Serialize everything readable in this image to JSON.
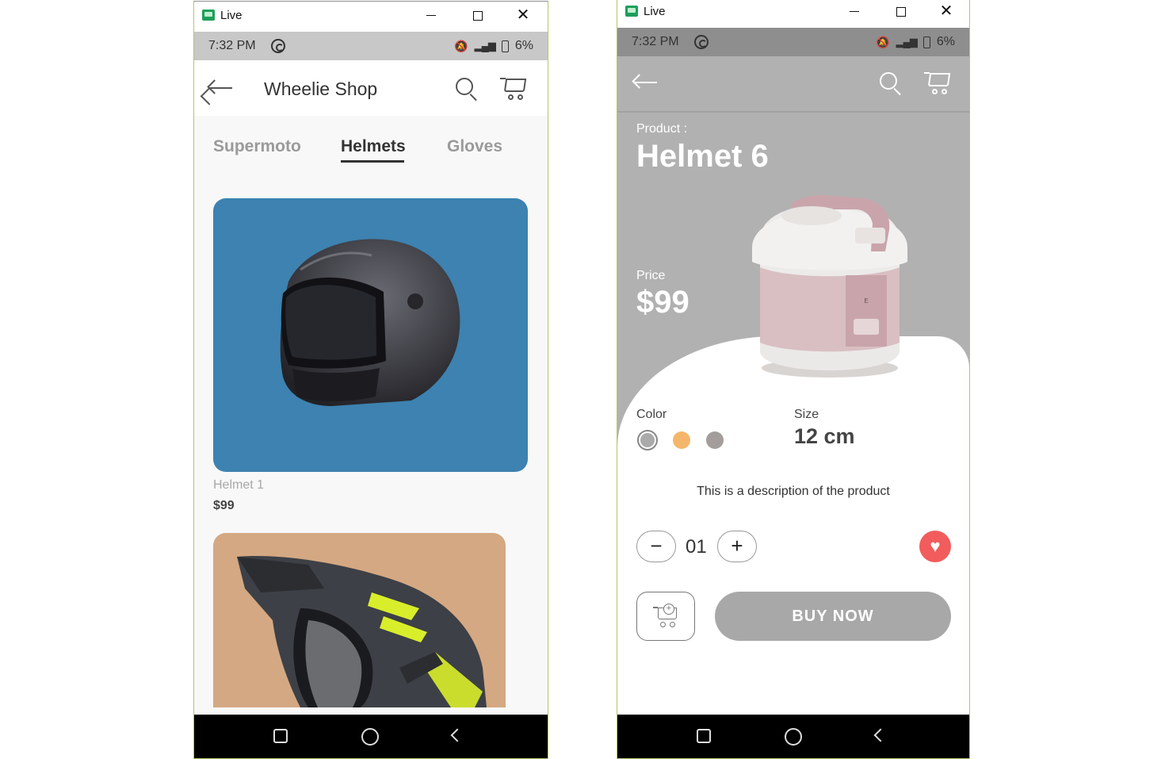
{
  "windows": [
    {
      "title": "Live",
      "status": {
        "time": "7:32 PM",
        "battery": "6%"
      },
      "appbar": {
        "title": "Wheelie Shop"
      },
      "tabs": [
        {
          "label": "Supermoto",
          "active": false
        },
        {
          "label": "Helmets",
          "active": true
        },
        {
          "label": "Gloves",
          "active": false
        }
      ],
      "products": [
        {
          "name": "Helmet 1",
          "price": "$99",
          "bg": "#3d82b0"
        },
        {
          "name": "",
          "price": "",
          "bg": "#d4a882"
        }
      ]
    },
    {
      "title": "Live",
      "status": {
        "time": "7:32 PM",
        "battery": "6%"
      },
      "detail": {
        "product_label": "Product :",
        "product_name": "Helmet 6",
        "price_label": "Price",
        "price": "$99",
        "color_label": "Color",
        "colors": [
          "#aaaaaa",
          "#f4b66a",
          "#a39e9c"
        ],
        "size_label": "Size",
        "size": "12 cm",
        "description": "This is a description of the product",
        "quantity": "01",
        "minus": "−",
        "plus": "+",
        "buy_label": "BUY  NOW"
      }
    }
  ],
  "icons": [
    "back-arrow-icon",
    "search-icon",
    "cart-icon",
    "sync-icon",
    "mute-icon",
    "signal-icon",
    "battery-icon",
    "heart-icon",
    "cart-add-icon",
    "nav-square-icon",
    "nav-circle-icon",
    "nav-back-icon"
  ]
}
